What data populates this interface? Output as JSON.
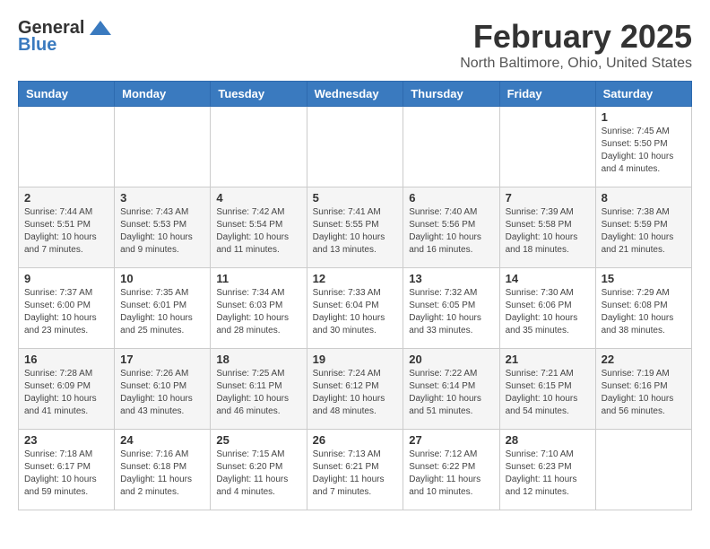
{
  "header": {
    "logo_general": "General",
    "logo_blue": "Blue",
    "month_title": "February 2025",
    "location": "North Baltimore, Ohio, United States"
  },
  "weekdays": [
    "Sunday",
    "Monday",
    "Tuesday",
    "Wednesday",
    "Thursday",
    "Friday",
    "Saturday"
  ],
  "weeks": [
    [
      {
        "day": "",
        "info": ""
      },
      {
        "day": "",
        "info": ""
      },
      {
        "day": "",
        "info": ""
      },
      {
        "day": "",
        "info": ""
      },
      {
        "day": "",
        "info": ""
      },
      {
        "day": "",
        "info": ""
      },
      {
        "day": "1",
        "info": "Sunrise: 7:45 AM\nSunset: 5:50 PM\nDaylight: 10 hours and 4 minutes."
      }
    ],
    [
      {
        "day": "2",
        "info": "Sunrise: 7:44 AM\nSunset: 5:51 PM\nDaylight: 10 hours and 7 minutes."
      },
      {
        "day": "3",
        "info": "Sunrise: 7:43 AM\nSunset: 5:53 PM\nDaylight: 10 hours and 9 minutes."
      },
      {
        "day": "4",
        "info": "Sunrise: 7:42 AM\nSunset: 5:54 PM\nDaylight: 10 hours and 11 minutes."
      },
      {
        "day": "5",
        "info": "Sunrise: 7:41 AM\nSunset: 5:55 PM\nDaylight: 10 hours and 13 minutes."
      },
      {
        "day": "6",
        "info": "Sunrise: 7:40 AM\nSunset: 5:56 PM\nDaylight: 10 hours and 16 minutes."
      },
      {
        "day": "7",
        "info": "Sunrise: 7:39 AM\nSunset: 5:58 PM\nDaylight: 10 hours and 18 minutes."
      },
      {
        "day": "8",
        "info": "Sunrise: 7:38 AM\nSunset: 5:59 PM\nDaylight: 10 hours and 21 minutes."
      }
    ],
    [
      {
        "day": "9",
        "info": "Sunrise: 7:37 AM\nSunset: 6:00 PM\nDaylight: 10 hours and 23 minutes."
      },
      {
        "day": "10",
        "info": "Sunrise: 7:35 AM\nSunset: 6:01 PM\nDaylight: 10 hours and 25 minutes."
      },
      {
        "day": "11",
        "info": "Sunrise: 7:34 AM\nSunset: 6:03 PM\nDaylight: 10 hours and 28 minutes."
      },
      {
        "day": "12",
        "info": "Sunrise: 7:33 AM\nSunset: 6:04 PM\nDaylight: 10 hours and 30 minutes."
      },
      {
        "day": "13",
        "info": "Sunrise: 7:32 AM\nSunset: 6:05 PM\nDaylight: 10 hours and 33 minutes."
      },
      {
        "day": "14",
        "info": "Sunrise: 7:30 AM\nSunset: 6:06 PM\nDaylight: 10 hours and 35 minutes."
      },
      {
        "day": "15",
        "info": "Sunrise: 7:29 AM\nSunset: 6:08 PM\nDaylight: 10 hours and 38 minutes."
      }
    ],
    [
      {
        "day": "16",
        "info": "Sunrise: 7:28 AM\nSunset: 6:09 PM\nDaylight: 10 hours and 41 minutes."
      },
      {
        "day": "17",
        "info": "Sunrise: 7:26 AM\nSunset: 6:10 PM\nDaylight: 10 hours and 43 minutes."
      },
      {
        "day": "18",
        "info": "Sunrise: 7:25 AM\nSunset: 6:11 PM\nDaylight: 10 hours and 46 minutes."
      },
      {
        "day": "19",
        "info": "Sunrise: 7:24 AM\nSunset: 6:12 PM\nDaylight: 10 hours and 48 minutes."
      },
      {
        "day": "20",
        "info": "Sunrise: 7:22 AM\nSunset: 6:14 PM\nDaylight: 10 hours and 51 minutes."
      },
      {
        "day": "21",
        "info": "Sunrise: 7:21 AM\nSunset: 6:15 PM\nDaylight: 10 hours and 54 minutes."
      },
      {
        "day": "22",
        "info": "Sunrise: 7:19 AM\nSunset: 6:16 PM\nDaylight: 10 hours and 56 minutes."
      }
    ],
    [
      {
        "day": "23",
        "info": "Sunrise: 7:18 AM\nSunset: 6:17 PM\nDaylight: 10 hours and 59 minutes."
      },
      {
        "day": "24",
        "info": "Sunrise: 7:16 AM\nSunset: 6:18 PM\nDaylight: 11 hours and 2 minutes."
      },
      {
        "day": "25",
        "info": "Sunrise: 7:15 AM\nSunset: 6:20 PM\nDaylight: 11 hours and 4 minutes."
      },
      {
        "day": "26",
        "info": "Sunrise: 7:13 AM\nSunset: 6:21 PM\nDaylight: 11 hours and 7 minutes."
      },
      {
        "day": "27",
        "info": "Sunrise: 7:12 AM\nSunset: 6:22 PM\nDaylight: 11 hours and 10 minutes."
      },
      {
        "day": "28",
        "info": "Sunrise: 7:10 AM\nSunset: 6:23 PM\nDaylight: 11 hours and 12 minutes."
      },
      {
        "day": "",
        "info": ""
      }
    ]
  ]
}
